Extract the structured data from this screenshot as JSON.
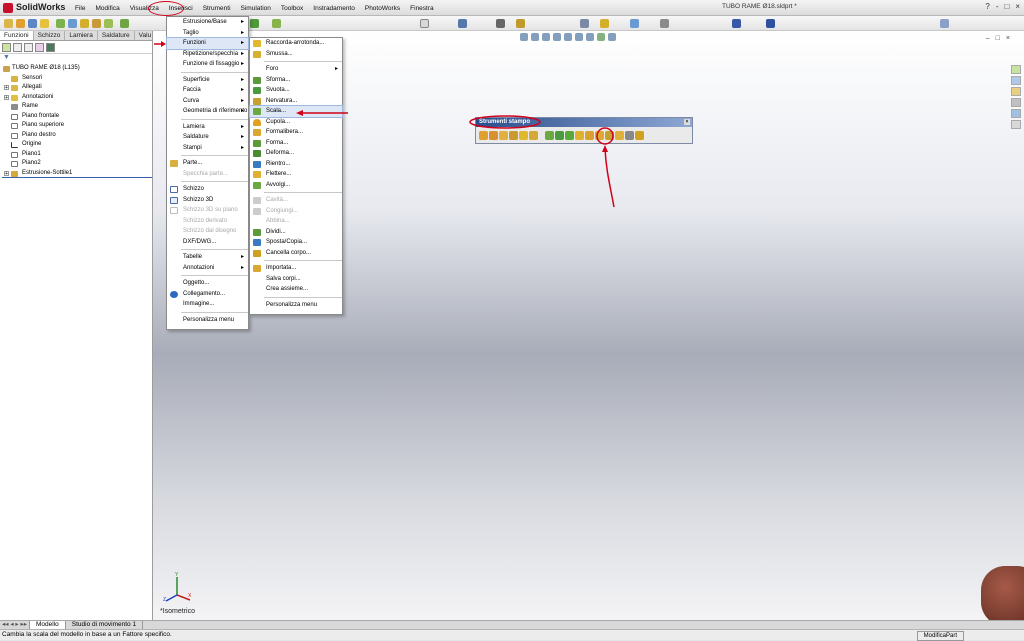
{
  "app": {
    "logo": "SolidWorks",
    "document_title": "TUBO RAME Ø18.sldprt *",
    "window_controls": [
      "?",
      "-",
      "□",
      "×"
    ]
  },
  "menubar": [
    "File",
    "Modifica",
    "Visualizza",
    "Inserisci",
    "Strumenti",
    "Simulation",
    "Toolbox",
    "Instradamento",
    "PhotoWorks",
    "Finestra"
  ],
  "feature_manager": {
    "tabs": [
      "Funzioni",
      "Schizzo",
      "Lamiera",
      "Saldature",
      "Valu"
    ],
    "tree": [
      {
        "label": "TUBO RAME Ø18  (L135)",
        "icon": "part-icon"
      },
      {
        "label": "Sensori",
        "icon": "sensor-icon"
      },
      {
        "label": "Allegati",
        "icon": "attachments-icon"
      },
      {
        "label": "Annotazioni",
        "icon": "annotations-icon"
      },
      {
        "label": "Rame",
        "icon": "material-icon"
      },
      {
        "label": "Piano frontale",
        "icon": "plane-icon"
      },
      {
        "label": "Piano superiore",
        "icon": "plane-icon"
      },
      {
        "label": "Piano destro",
        "icon": "plane-icon"
      },
      {
        "label": "Origine",
        "icon": "origin-icon"
      },
      {
        "label": "Piano1",
        "icon": "plane-icon"
      },
      {
        "label": "Piano2",
        "icon": "plane-icon"
      },
      {
        "label": "Estrusione-Sottile1",
        "icon": "extrude-icon"
      }
    ]
  },
  "insert_menu": {
    "items": [
      {
        "label": "Estrusione/Base",
        "submenu": true
      },
      {
        "label": "Taglio",
        "submenu": true
      },
      {
        "label": "Funzioni",
        "submenu": true,
        "highlighted": true
      },
      {
        "label": "Ripetizione/specchia",
        "submenu": true
      },
      {
        "label": "Funzione di fissaggio",
        "submenu": true
      },
      {
        "label": "Superficie",
        "submenu": true
      },
      {
        "label": "Faccia",
        "submenu": true
      },
      {
        "label": "Curva",
        "submenu": true
      },
      {
        "label": "Geometria di riferimento",
        "submenu": true
      },
      {
        "label": "Lamiera",
        "submenu": true
      },
      {
        "label": "Saldature",
        "submenu": true
      },
      {
        "label": "Stampi",
        "submenu": true
      },
      {
        "label": "Parte..."
      },
      {
        "label": "Specchia parte...",
        "disabled": true
      },
      {
        "label": "Schizzo"
      },
      {
        "label": "Schizzo 3D"
      },
      {
        "label": "Schizzo 3D su piano",
        "disabled": true
      },
      {
        "label": "Schizzo derivato",
        "disabled": true
      },
      {
        "label": "Schizzo dal disegno",
        "disabled": true
      },
      {
        "label": "DXF/DWG..."
      },
      {
        "label": "Tabelle",
        "submenu": true
      },
      {
        "label": "Annotazioni",
        "submenu": true
      },
      {
        "label": "Oggetto..."
      },
      {
        "label": "Collegamento..."
      },
      {
        "label": "Immagine..."
      },
      {
        "label": "Personalizza menu"
      }
    ]
  },
  "features_submenu": {
    "items": [
      {
        "label": "Raccorda-arrotonda..."
      },
      {
        "label": "Smussa..."
      },
      {
        "label": "Foro",
        "submenu": true
      },
      {
        "label": "Sforma..."
      },
      {
        "label": "Svuota..."
      },
      {
        "label": "Nervatura..."
      },
      {
        "label": "Scala...",
        "highlighted": true
      },
      {
        "label": "Cupola..."
      },
      {
        "label": "Formalibera..."
      },
      {
        "label": "Forma..."
      },
      {
        "label": "Deforma..."
      },
      {
        "label": "Rientro..."
      },
      {
        "label": "Flettere..."
      },
      {
        "label": "Avvolgi..."
      },
      {
        "label": "Cavità...",
        "disabled": true
      },
      {
        "label": "Congiungi...",
        "disabled": true
      },
      {
        "label": "Abbina...",
        "disabled": true
      },
      {
        "label": "Dividi..."
      },
      {
        "label": "Sposta/Copia..."
      },
      {
        "label": "Cancella corpo..."
      },
      {
        "label": "Importata..."
      },
      {
        "label": "Salva corpi..."
      },
      {
        "label": "Crea assieme..."
      },
      {
        "label": "Personalizza menu"
      }
    ]
  },
  "mold_toolbar": {
    "title": "Strumenti stampo",
    "close": "×"
  },
  "viewport": {
    "view_label": "*Isometrico"
  },
  "bottom_tabs": [
    "Modello",
    "Studio di movimento 1"
  ],
  "status": {
    "text": "Cambia la scala del modello in base a un Fattore specifico.",
    "mode": "ModificaPart"
  },
  "colors": {
    "annotation_red": "#d0021b",
    "menu_highlight": "#dde7f5",
    "mold_title": "#2a4d8c"
  }
}
